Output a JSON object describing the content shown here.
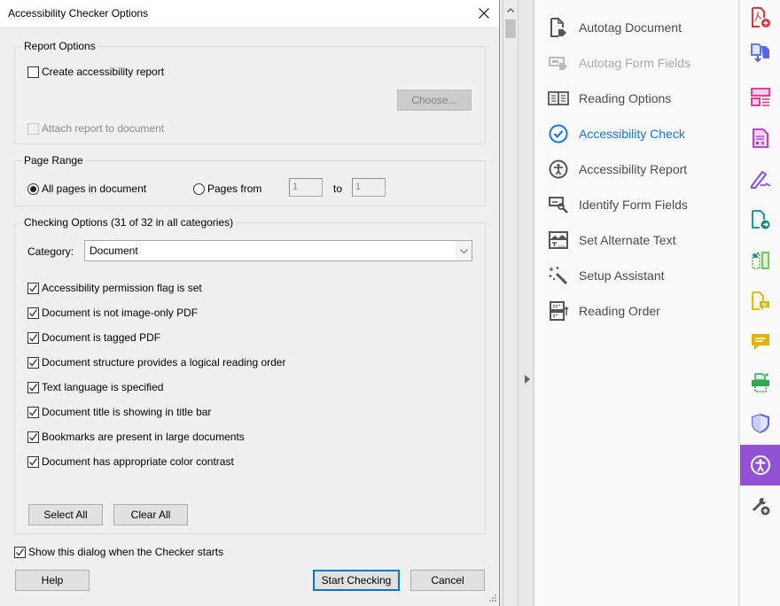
{
  "dialog": {
    "title": "Accessibility Checker Options",
    "close_icon": "close-icon",
    "report_options": {
      "legend": "Report Options",
      "create_report": {
        "label": "Create accessibility report",
        "checked": false,
        "enabled": true
      },
      "choose_button": {
        "label": "Choose...",
        "enabled": false
      },
      "attach_report": {
        "label": "Attach report to document",
        "checked": false,
        "enabled": false
      }
    },
    "page_range": {
      "legend": "Page Range",
      "all_pages": {
        "label": "All pages in document",
        "selected": true
      },
      "pages_from": {
        "label": "Pages from",
        "selected": false
      },
      "from_value": "1",
      "to_label": "to",
      "to_value": "1"
    },
    "checking_options": {
      "legend": "Checking Options (31 of 32 in all categories)",
      "category_label": "Category:",
      "category_value": "Document",
      "items": [
        {
          "label": "Accessibility permission flag is set",
          "checked": true
        },
        {
          "label": "Document is not image-only PDF",
          "checked": true
        },
        {
          "label": "Document is tagged PDF",
          "checked": true
        },
        {
          "label": "Document structure provides a logical reading order",
          "checked": true
        },
        {
          "label": "Text language is specified",
          "checked": true
        },
        {
          "label": "Document title is showing in title bar",
          "checked": true
        },
        {
          "label": "Bookmarks are present in large documents",
          "checked": true
        },
        {
          "label": "Document has appropriate color contrast",
          "checked": true
        }
      ],
      "select_all_label": "Select All",
      "clear_all_label": "Clear All"
    },
    "show_dialog": {
      "label": "Show this dialog when the Checker starts",
      "checked": true
    },
    "help_label": "Help",
    "start_label": "Start Checking",
    "cancel_label": "Cancel"
  },
  "tools_panel": {
    "items": [
      {
        "label": "Autotag Document",
        "icon": "autotag-document-icon",
        "state": "normal"
      },
      {
        "label": "Autotag Form Fields",
        "icon": "autotag-form-fields-icon",
        "state": "disabled"
      },
      {
        "label": "Reading Options",
        "icon": "reading-options-icon",
        "state": "normal"
      },
      {
        "label": "Accessibility Check",
        "icon": "accessibility-check-icon",
        "state": "active"
      },
      {
        "label": "Accessibility Report",
        "icon": "accessibility-report-icon",
        "state": "normal"
      },
      {
        "label": "Identify Form Fields",
        "icon": "identify-form-fields-icon",
        "state": "normal"
      },
      {
        "label": "Set Alternate Text",
        "icon": "set-alternate-text-icon",
        "state": "normal"
      },
      {
        "label": "Setup Assistant",
        "icon": "setup-assistant-icon",
        "state": "normal"
      },
      {
        "label": "Reading Order",
        "icon": "reading-order-icon",
        "state": "normal"
      }
    ]
  },
  "right_rail": {
    "items": [
      {
        "icon": "create-pdf-icon",
        "color": "#e0343a"
      },
      {
        "icon": "export-pdf-icon",
        "color": "#5565e6"
      },
      {
        "icon": "organize-pages-icon",
        "color": "#d7308c"
      },
      {
        "icon": "edit-pdf-icon",
        "color": "#b62fc9"
      },
      {
        "icon": "fill-sign-icon",
        "color": "#8a4ede"
      },
      {
        "icon": "send-for-review-icon",
        "color": "#16878c"
      },
      {
        "icon": "compare-icon",
        "color": "#6cc24a"
      },
      {
        "icon": "comment-doc-icon",
        "color": "#e0b400"
      },
      {
        "icon": "comment-icon",
        "color": "#e0b400"
      },
      {
        "icon": "print-production-icon",
        "color": "#2fa84f"
      },
      {
        "icon": "protect-icon",
        "color": "#5565e6"
      },
      {
        "icon": "accessibility-icon",
        "color": "#ffffff",
        "active": true
      },
      {
        "icon": "more-tools-icon",
        "color": "#555555"
      }
    ],
    "active_bg": "#9352d6"
  },
  "colors": {
    "accent_blue": "#1473e6",
    "default_button_border": "#0078d7"
  }
}
